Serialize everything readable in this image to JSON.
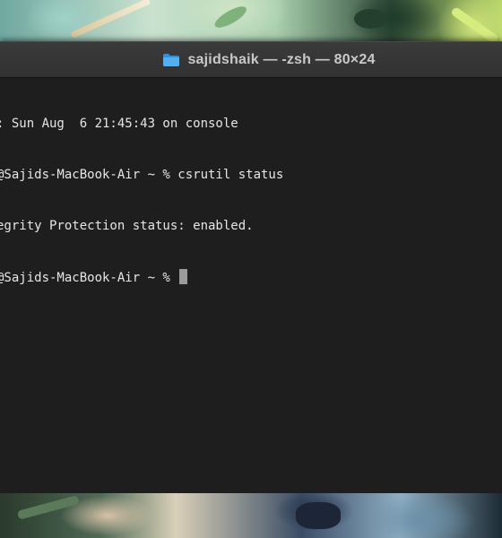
{
  "window": {
    "title": "sajidshaik — -zsh — 80×24",
    "title_icon": "folder-icon",
    "accent": "#3aa0e8"
  },
  "terminal": {
    "lines": [
      ": Sun Aug  6 21:45:43 on console",
      "@Sajids-MacBook-Air ~ % csrutil status",
      "egrity Protection status: enabled.",
      "@Sajids-MacBook-Air ~ % "
    ],
    "cursor": "block-cursor",
    "background": "#1e1e1e",
    "foreground": "#e6e6e6"
  }
}
